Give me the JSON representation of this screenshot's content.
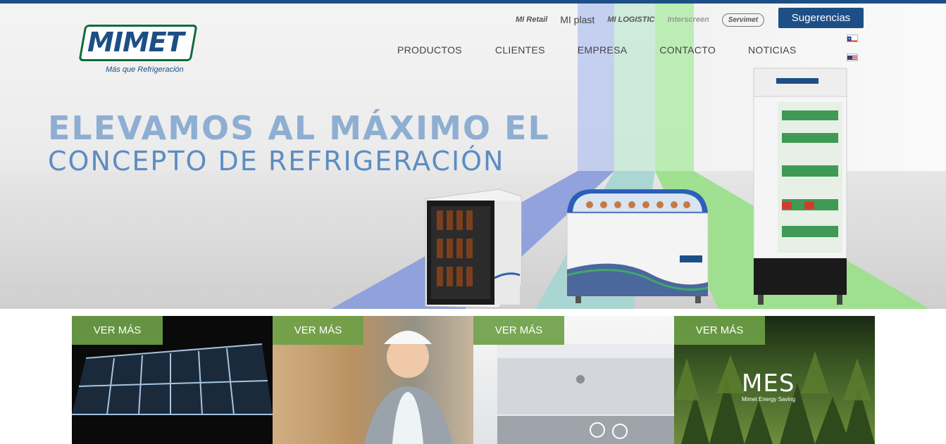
{
  "brand": {
    "logo_text": "MIMET",
    "tagline": "Más que Refrigeración"
  },
  "brands": [
    {
      "label": "MI Retail"
    },
    {
      "label": "MI plast"
    },
    {
      "label": "MI LOGISTIC"
    },
    {
      "label": "Interscreen"
    },
    {
      "label": "Servimet"
    }
  ],
  "header": {
    "suggestions_button": "Sugerencias"
  },
  "nav": {
    "items": [
      {
        "label": "PRODUCTOS"
      },
      {
        "label": "CLIENTES"
      },
      {
        "label": "EMPRESA"
      },
      {
        "label": "CONTACTO"
      },
      {
        "label": "NOTICIAS"
      }
    ]
  },
  "languages": [
    {
      "name": "Chile"
    },
    {
      "name": "United States"
    }
  ],
  "hero": {
    "headline_line1": "ELEVAMOS AL MÁXIMO EL",
    "headline_line2": "CONCEPTO DE REFRIGERACIÓN"
  },
  "tiles": [
    {
      "button": "VER MÁS"
    },
    {
      "button": "VER MÁS"
    },
    {
      "button": "VER MÁS"
    },
    {
      "button": "VER MÁS",
      "overlay_text": "MES",
      "overlay_subtext": "Mimet Energy Saving"
    }
  ],
  "colors": {
    "primary": "#1d4f86",
    "accent_green": "#6ea046",
    "beam_blue": "#8c9edb",
    "beam_green": "#9be08c"
  }
}
